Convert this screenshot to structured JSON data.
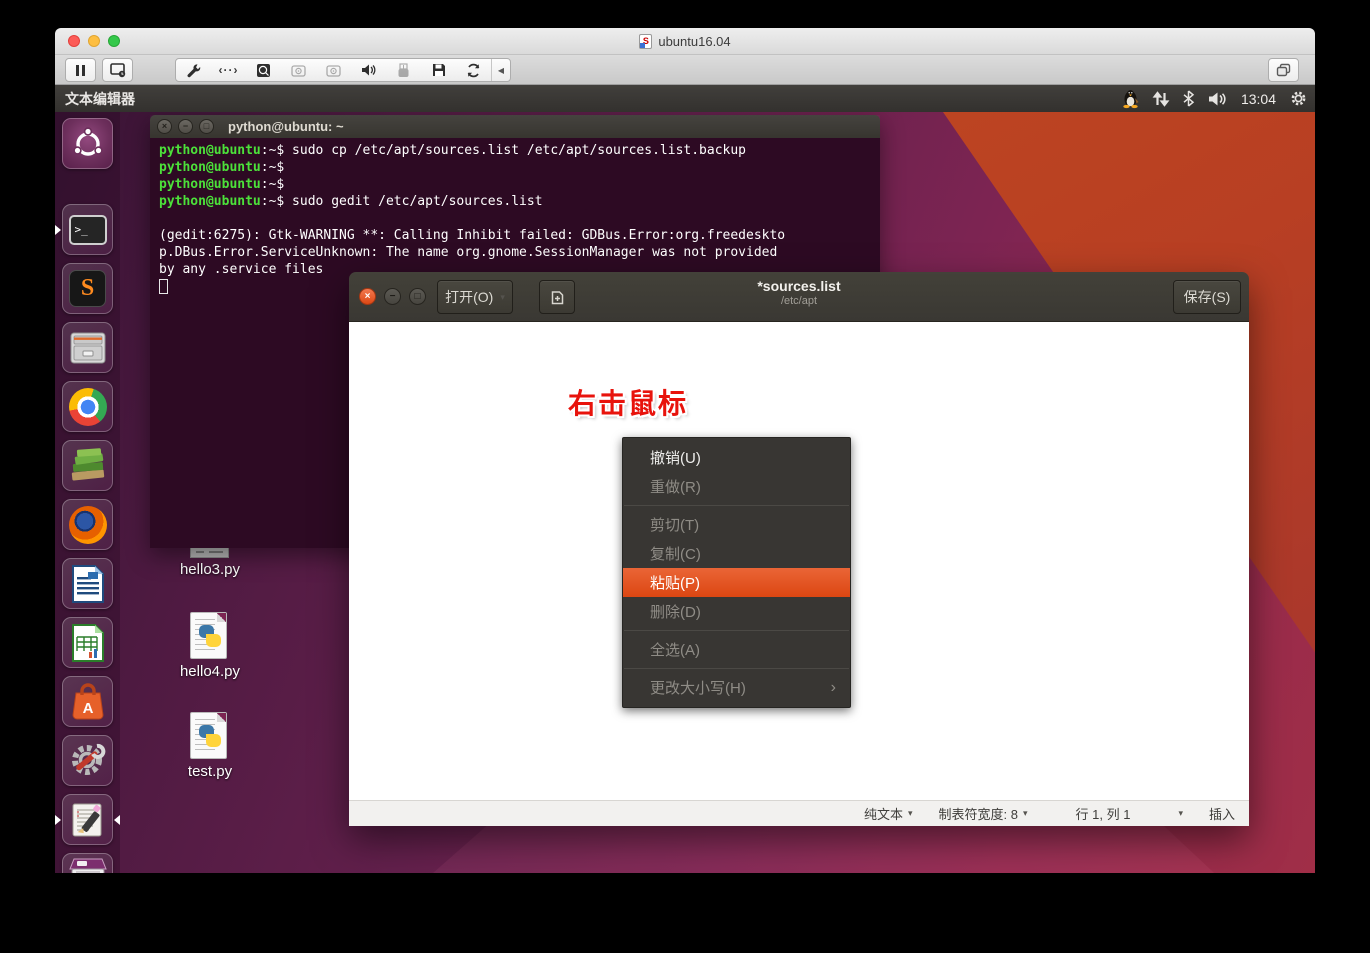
{
  "host_window": {
    "title": "ubuntu16.04",
    "toolbar_icons": [
      "pause",
      "snapshot",
      "wrench",
      "network",
      "harddisk",
      "cd-1",
      "cd-2",
      "audio",
      "usb",
      "floppy",
      "sync",
      "collapse"
    ]
  },
  "panel": {
    "app_name": "文本编辑器",
    "clock": "13:04",
    "tray_icons": [
      "tux",
      "network-arrows",
      "bluetooth",
      "volume",
      "clock",
      "session-gear"
    ]
  },
  "launcher": {
    "items": [
      "dash-home",
      "terminal",
      "sublime-text",
      "file-manager",
      "chrome",
      "books",
      "firefox",
      "libreoffice-writer",
      "libreoffice-calc",
      "ubuntu-software",
      "system-settings",
      "text-editor",
      "printer"
    ]
  },
  "terminal": {
    "title": "python@ubuntu: ~",
    "lines": [
      {
        "prompt": "python@ubuntu",
        "sep": ":~$",
        "cmd": " sudo cp /etc/apt/sources.list /etc/apt/sources.list.backup"
      },
      {
        "prompt": "python@ubuntu",
        "sep": ":~$"
      },
      {
        "prompt": "python@ubuntu",
        "sep": ":~$"
      },
      {
        "prompt": "python@ubuntu",
        "sep": ":~$",
        "cmd": " sudo gedit /etc/apt/sources.list"
      },
      {
        "text": ""
      },
      {
        "text": "(gedit:6275): Gtk-WARNING **: Calling Inhibit failed: GDBus.Error:org.freedeskto"
      },
      {
        "text": "p.DBus.Error.ServiceUnknown: The name org.gnome.SessionManager was not provided"
      },
      {
        "text": "by any .service files"
      }
    ]
  },
  "gedit": {
    "open_label": "打开(O)",
    "title": "*sources.list",
    "subtitle": "/etc/apt",
    "save_label": "保存(S)",
    "statusbar": {
      "doc_type": "纯文本",
      "tab_width": "制表符宽度: 8",
      "cursor_pos": "行 1, 列 1",
      "mode": "插入"
    }
  },
  "context_menu": {
    "items": [
      {
        "label": "撤销(U)",
        "state": "enabled"
      },
      {
        "label": "重做(R)",
        "state": "disabled"
      },
      {
        "label": "剪切(T)",
        "state": "disabled"
      },
      {
        "label": "复制(C)",
        "state": "disabled"
      },
      {
        "label": "粘贴(P)",
        "state": "highlighted"
      },
      {
        "label": "删除(D)",
        "state": "disabled"
      },
      {
        "label": "全选(A)",
        "state": "disabled"
      },
      {
        "label": "更改大小写(H)",
        "state": "disabled",
        "has_submenu": true
      }
    ]
  },
  "annotation": {
    "text": "右击鼠标",
    "color": "#e8130c"
  },
  "desktop": {
    "files": [
      {
        "label": "hello3.py"
      },
      {
        "label": "hello4.py"
      },
      {
        "label": "test.py"
      }
    ]
  },
  "glyphs": {
    "caret_down": "▾",
    "submenu_arrow": "›",
    "collapse_left": "◀",
    "terminal_prompt_glyph": ">_",
    "sublime_glyph": "S",
    "software_glyph": "A"
  },
  "colors": {
    "ubuntu_orange": "#dd4814",
    "menu_highlight": "#e0551f",
    "terminal_green": "#4ce13a",
    "terminal_bg": "#2d0a23",
    "panel_bg": "#3a3836",
    "annotation_red": "#e8130c"
  }
}
